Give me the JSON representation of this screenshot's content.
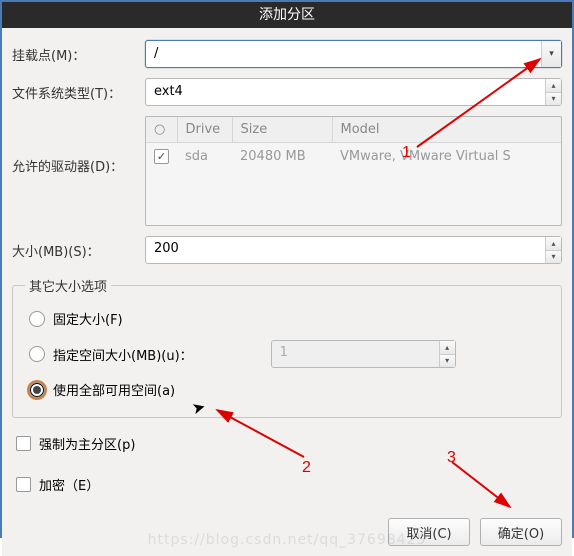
{
  "window": {
    "title": "添加分区"
  },
  "mount_point": {
    "label": "挂载点(M)：",
    "value": "/"
  },
  "fs_type": {
    "label": "文件系统类型(T)：",
    "value": "ext4"
  },
  "drives": {
    "label": "允许的驱动器(D)：",
    "headers": {
      "check": "○",
      "drive": "Drive",
      "size": "Size",
      "model": "Model"
    },
    "rows": [
      {
        "checked": true,
        "drive": "sda",
        "size": "20480 MB",
        "model": "VMware, VMware Virtual S"
      }
    ]
  },
  "size": {
    "label": "大小(MB)(S)：",
    "value": "200"
  },
  "size_options": {
    "legend": "其它大小选项",
    "fixed": "固定大小(F)",
    "fill_to": "指定空间大小(MB)(u)：",
    "fill_to_value": "1",
    "fill_max": "使用全部可用空间(a)",
    "selected": "fill_max"
  },
  "primary": {
    "label": "强制为主分区(p)",
    "checked": false
  },
  "encrypt": {
    "label": "加密（E）",
    "checked": false
  },
  "buttons": {
    "cancel": "取消(C)",
    "ok": "确定(O)"
  },
  "annotations": {
    "a1": "1",
    "a2": "2",
    "a3": "3"
  },
  "watermark": "https://blog.csdn.net/qq_37698425"
}
